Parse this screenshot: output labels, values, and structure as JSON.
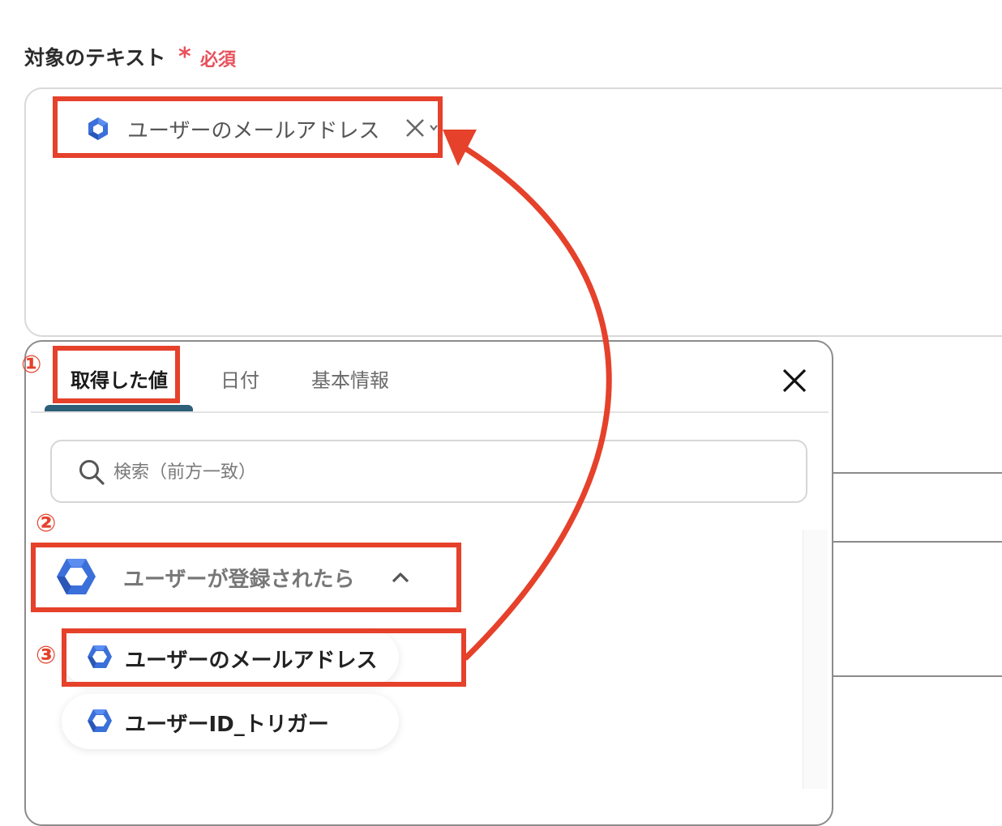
{
  "field": {
    "label": "対象のテキスト",
    "required_mark": "*",
    "required_text": "必須"
  },
  "chip": {
    "label": "ユーザーのメールアドレス",
    "icon": "google-workspace-hexagon-icon",
    "remove_icon": "close-icon"
  },
  "tabs": [
    {
      "label": "取得した値",
      "active": true
    },
    {
      "label": "日付",
      "active": false
    },
    {
      "label": "基本情報",
      "active": false
    }
  ],
  "search": {
    "placeholder": "検索（前方一致）"
  },
  "group": {
    "label": "ユーザーが登録されたら",
    "expanded": true
  },
  "items": [
    {
      "label": "ユーザーのメールアドレス"
    },
    {
      "label": "ユーザーID_トリガー"
    }
  ],
  "annotations": {
    "step1": "①",
    "step2": "②",
    "step3": "③",
    "color": "#e5412b"
  },
  "colors": {
    "accent": "#2d5f78",
    "required": "#e8505b",
    "icon_blue": "#3b6fd9"
  }
}
